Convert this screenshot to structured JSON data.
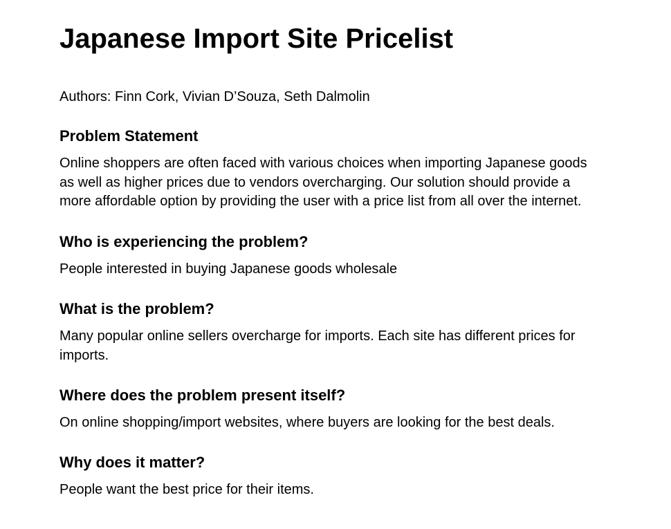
{
  "document": {
    "title": "Japanese Import Site Pricelist",
    "authors": "Authors: Finn Cork, Vivian D’Souza, Seth Dalmolin",
    "sections": [
      {
        "heading": "Problem Statement",
        "body": "Online shoppers are often faced with various choices when importing Japanese goods as well as higher prices due to vendors overcharging. Our solution should provide a more affordable option by providing the user with a price list from all over the internet."
      },
      {
        "heading": "Who is experiencing the problem?",
        "body": "People interested in buying Japanese goods wholesale"
      },
      {
        "heading": "What is the problem?",
        "body": "Many popular online sellers overcharge for imports. Each site has different prices for imports."
      },
      {
        "heading": "Where does the problem present itself?",
        "body": "On online shopping/import websites, where buyers are looking for the best deals."
      },
      {
        "heading": "Why does it matter?",
        "body": "People want the best price for their items."
      }
    ]
  }
}
